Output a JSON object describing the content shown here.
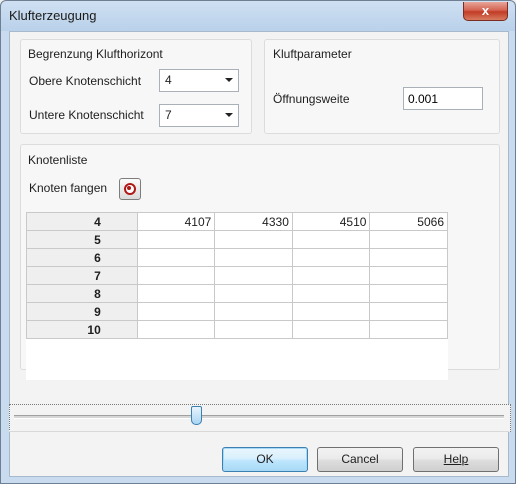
{
  "window": {
    "title": "Klufterzeugung",
    "close_glyph": "x"
  },
  "boundary_group": {
    "title": "Begrenzung Klufthorizont",
    "upper_label": "Obere Knotenschicht",
    "upper_value": "4",
    "lower_label": "Untere Knotenschicht",
    "lower_value": "7"
  },
  "params_group": {
    "title": "Kluftparameter",
    "opening_label": "Öffnungsweite",
    "opening_value": "0.001"
  },
  "node_group": {
    "title": "Knotenliste",
    "capture_label": "Knoten fangen",
    "capture_icon": "target-icon"
  },
  "grid": {
    "rows": [
      {
        "header": "4",
        "cells": [
          "4107",
          "4330",
          "4510",
          "5066"
        ]
      },
      {
        "header": "5",
        "cells": [
          "",
          "",
          "",
          ""
        ]
      },
      {
        "header": "6",
        "cells": [
          "",
          "",
          "",
          ""
        ]
      },
      {
        "header": "7",
        "cells": [
          "",
          "",
          "",
          ""
        ]
      },
      {
        "header": "8",
        "cells": [
          "",
          "",
          "",
          ""
        ]
      },
      {
        "header": "9",
        "cells": [
          "",
          "",
          "",
          ""
        ]
      },
      {
        "header": "10",
        "cells": [
          "",
          "",
          "",
          ""
        ]
      }
    ]
  },
  "slider": {
    "position_fraction": 0.37
  },
  "buttons": {
    "ok": "OK",
    "cancel": "Cancel",
    "help": "Help"
  },
  "colors": {
    "title_bar": "#b9d1ea",
    "close": "#c23b25",
    "default_button_border": "#3c7fb1"
  }
}
